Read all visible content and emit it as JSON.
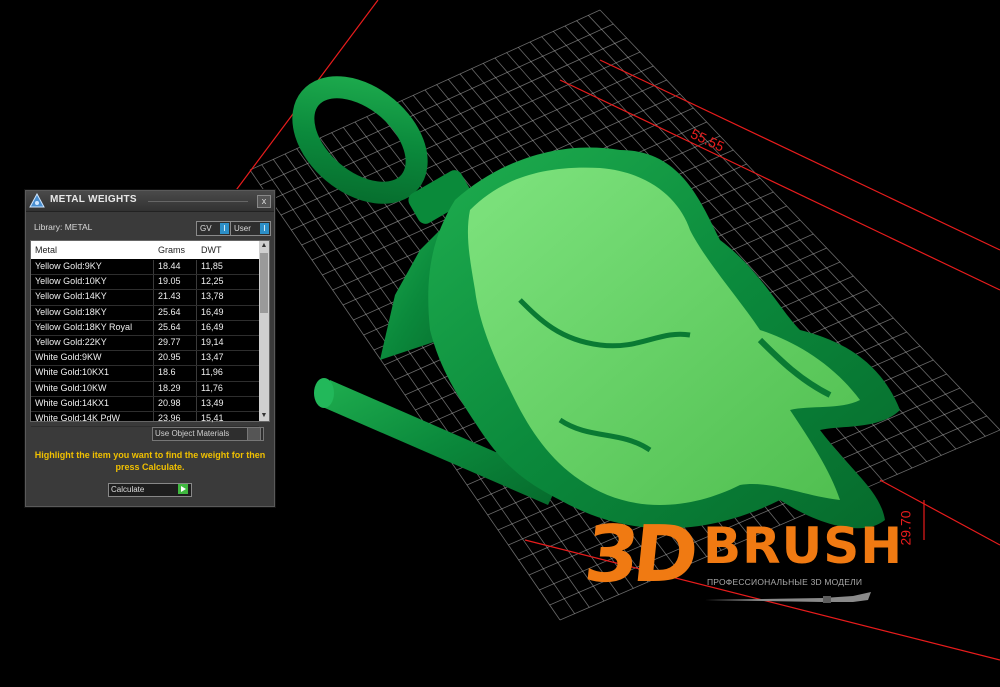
{
  "dialog": {
    "title": "METAL WEIGHTS",
    "close": "x",
    "library_label": "Library: METAL",
    "toggles": {
      "gv": "GV",
      "user": "User"
    },
    "columns": [
      "Metal",
      "Grams",
      "DWT"
    ],
    "rows": [
      {
        "metal": "Yellow Gold:9KY",
        "grams": "18.44",
        "dwt": "11,85"
      },
      {
        "metal": "Yellow Gold:10KY",
        "grams": "19.05",
        "dwt": "12,25"
      },
      {
        "metal": "Yellow Gold:14KY",
        "grams": "21.43",
        "dwt": "13,78"
      },
      {
        "metal": "Yellow Gold:18KY",
        "grams": "25.64",
        "dwt": "16,49"
      },
      {
        "metal": "Yellow Gold:18KY Royal",
        "grams": "25.64",
        "dwt": "16,49"
      },
      {
        "metal": "Yellow Gold:22KY",
        "grams": "29.77",
        "dwt": "19,14"
      },
      {
        "metal": "White Gold:9KW",
        "grams": "20.95",
        "dwt": "13,47"
      },
      {
        "metal": "White Gold:10KX1",
        "grams": "18.6",
        "dwt": "11,96"
      },
      {
        "metal": "White Gold:10KW",
        "grams": "18.29",
        "dwt": "11,76"
      },
      {
        "metal": "White Gold:14KX1",
        "grams": "20.98",
        "dwt": "13,49"
      },
      {
        "metal": "White Gold:14K PdW",
        "grams": "23.96",
        "dwt": "15,41"
      }
    ],
    "use_object_materials": "Use Object Materials",
    "hint": "Highlight the item you want to find the weight for then press Calculate.",
    "calculate": "Calculate"
  },
  "viewport": {
    "dimension_length": "55.55",
    "dimension_width": "29.70"
  },
  "logo": {
    "mark": "3D",
    "name": "BRUSH",
    "tagline": "ПРОФЕССИОНАЛЬНЫЕ 3D МОДЕЛИ"
  },
  "colors": {
    "model_dark": "#0b8a3c",
    "model_light": "#5fd45f",
    "grid": "#bdbdbd",
    "dimension": "#e81c1c",
    "hint_text": "#f0c000",
    "logo": "#f07a12"
  }
}
